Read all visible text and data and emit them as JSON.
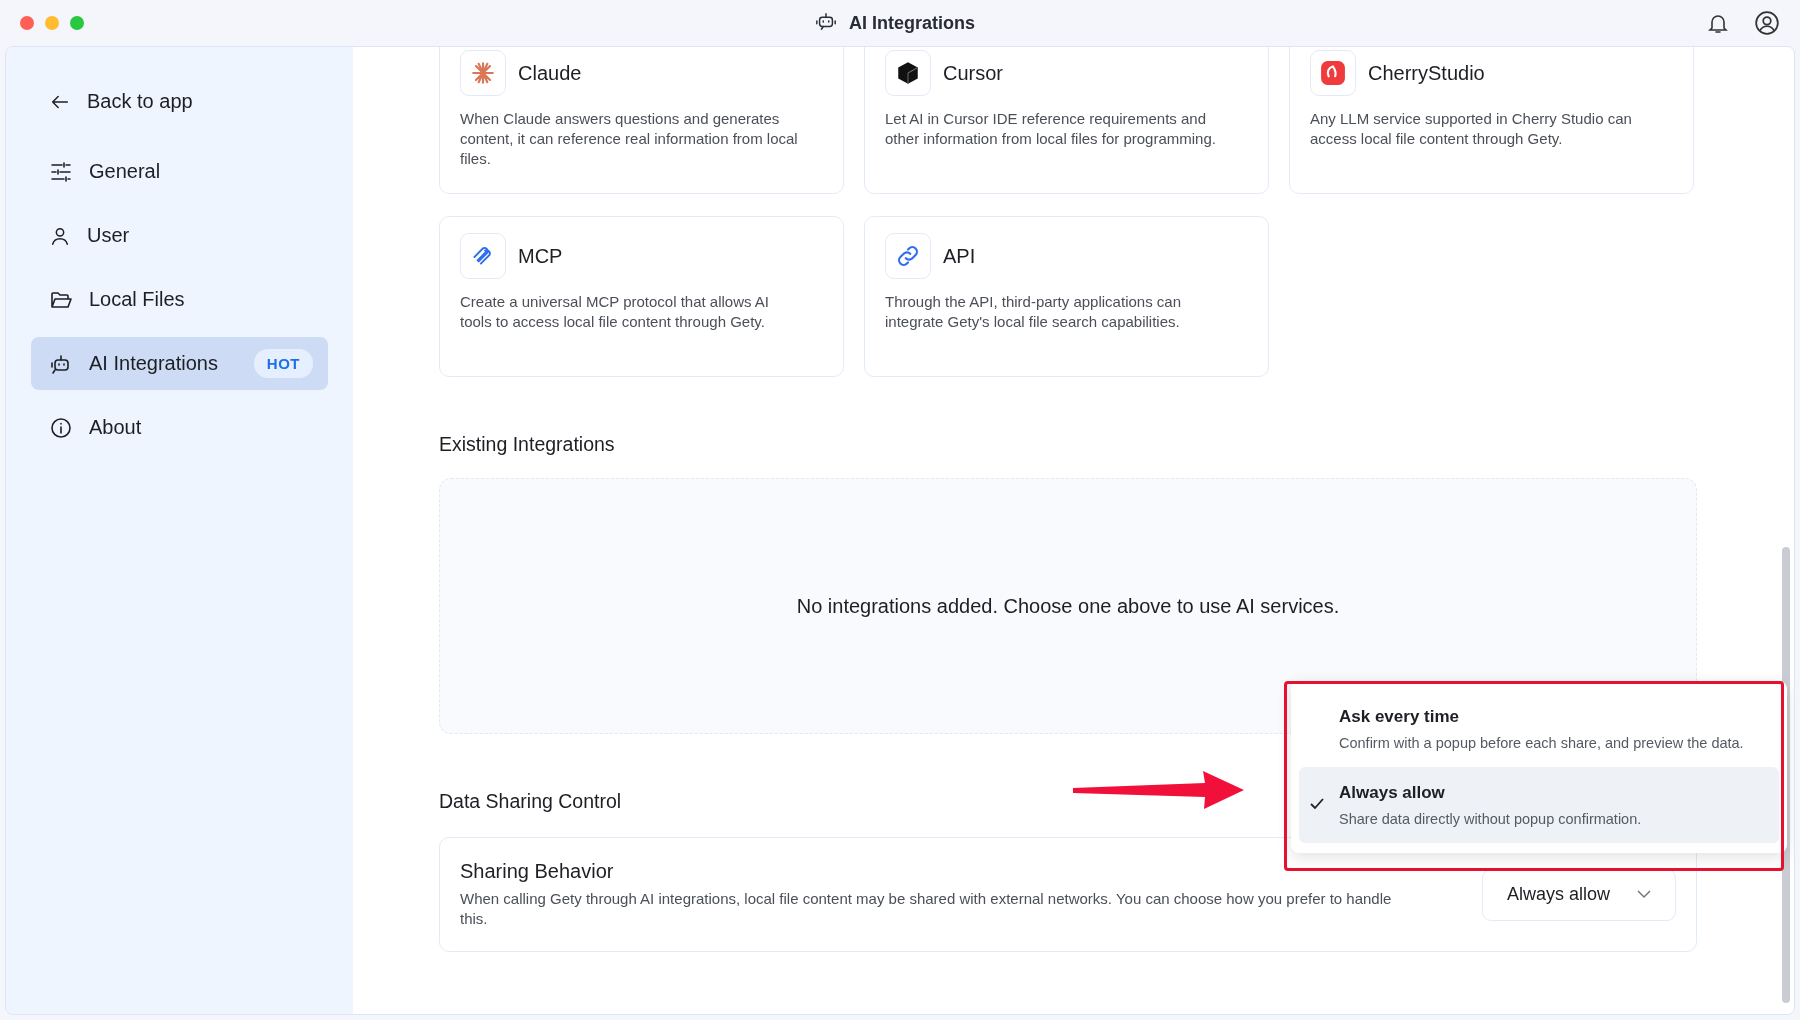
{
  "window": {
    "title": "AI Integrations"
  },
  "sidebar": {
    "back_link": {
      "label": "Back to app"
    },
    "items": [
      {
        "label": "General",
        "selected": false
      },
      {
        "label": "User",
        "selected": false
      },
      {
        "label": "Local Files",
        "selected": false
      },
      {
        "label": "AI Integrations",
        "selected": true,
        "badge": "HOT"
      },
      {
        "label": "About",
        "selected": false
      }
    ]
  },
  "integration_cards": [
    {
      "title": "Claude",
      "description": "When Claude answers questions and generates content, it can reference real information from local files."
    },
    {
      "title": "Cursor",
      "description": "Let AI in Cursor IDE reference requirements and other information from local files for programming."
    },
    {
      "title": "CherryStudio",
      "description": "Any LLM service supported in Cherry Studio can access local file content through Gety."
    },
    {
      "title": "MCP",
      "description": "Create a universal MCP protocol that allows AI tools to access local file content through Gety."
    },
    {
      "title": "API",
      "description": "Through the API, third-party applications can integrate Gety's local file search capabilities."
    }
  ],
  "existing_integrations": {
    "heading": "Existing Integrations",
    "empty_message": "No integrations added. Choose one above to use AI services."
  },
  "data_sharing": {
    "heading": "Data Sharing Control",
    "setting": {
      "title": "Sharing Behavior",
      "description": "When calling Gety through AI integrations, local file content may be shared with external networks. You can choose how you prefer to handle this.",
      "value": "Always allow"
    },
    "dropdown_options": [
      {
        "label": "Ask every time",
        "description": "Confirm with a popup before each share, and preview the data.",
        "selected": false
      },
      {
        "label": "Always allow",
        "description": "Share data directly without popup confirmation.",
        "selected": true
      }
    ]
  }
}
